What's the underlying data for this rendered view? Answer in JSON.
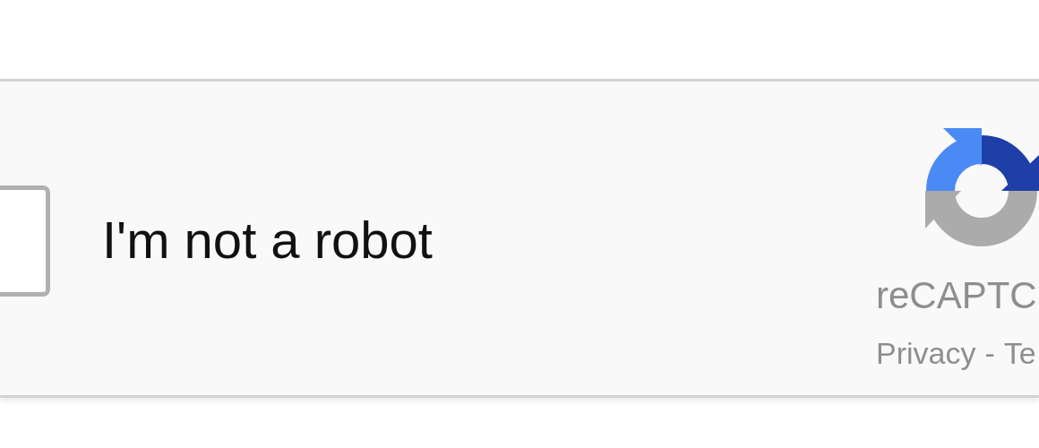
{
  "checkbox": {
    "label": "I'm not a robot",
    "checked": false
  },
  "brand": {
    "name": "reCAPTC",
    "links": [
      "Privacy",
      "Te"
    ],
    "separator": "-"
  }
}
